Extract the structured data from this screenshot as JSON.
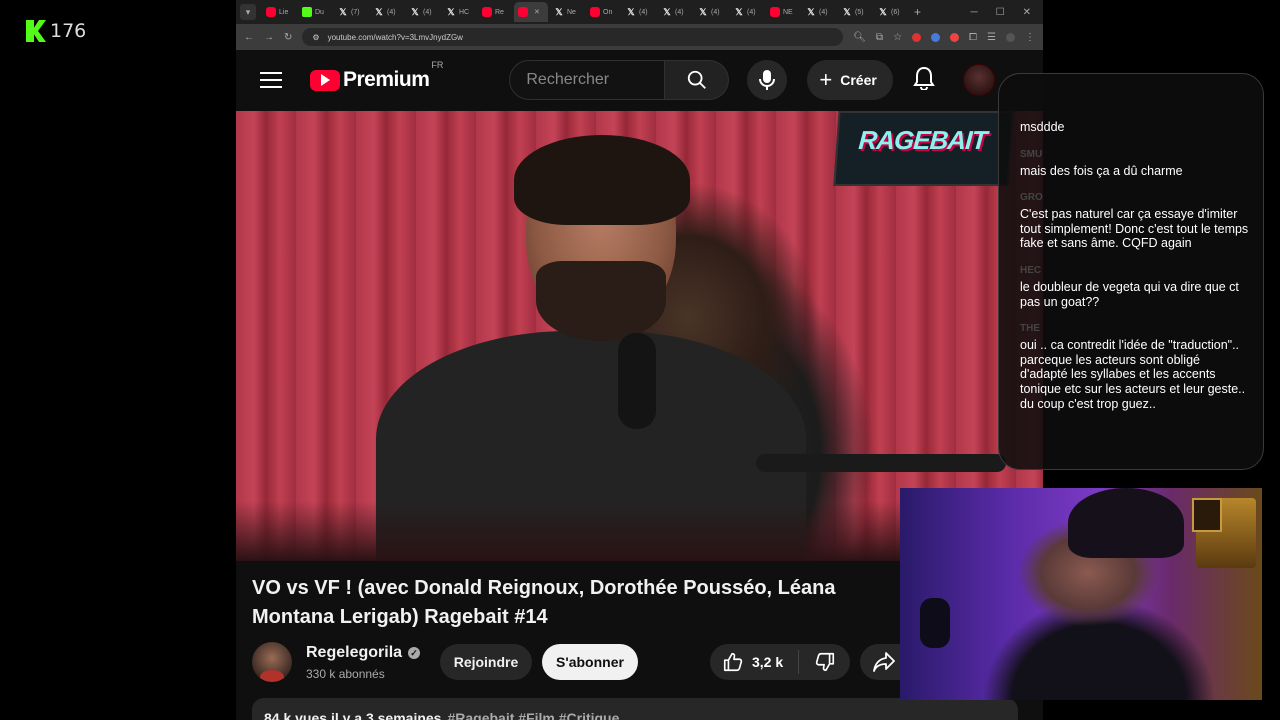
{
  "stream_badge": {
    "viewer_count": "176"
  },
  "browser": {
    "tabs": [
      {
        "icon": "yt",
        "label": "Lie"
      },
      {
        "icon": "k",
        "label": "Du"
      },
      {
        "icon": "x",
        "label": "(7)"
      },
      {
        "icon": "x",
        "label": "(4)"
      },
      {
        "icon": "x",
        "label": "(4)"
      },
      {
        "icon": "x",
        "label": "HC"
      },
      {
        "icon": "yt",
        "label": "Re"
      },
      {
        "icon": "yt",
        "label": "",
        "active": true
      },
      {
        "icon": "x",
        "label": "Ne"
      },
      {
        "icon": "yt",
        "label": "On"
      },
      {
        "icon": "x",
        "label": "(4)"
      },
      {
        "icon": "x",
        "label": "(4)"
      },
      {
        "icon": "x",
        "label": "(4)"
      },
      {
        "icon": "x",
        "label": "(4)"
      },
      {
        "icon": "yt",
        "label": "NE"
      },
      {
        "icon": "x",
        "label": "(4)"
      },
      {
        "icon": "x",
        "label": "(5)"
      },
      {
        "icon": "x",
        "label": "(6)"
      }
    ],
    "url": "youtube.com/watch?v=3LmvJnydZGw"
  },
  "youtube": {
    "brand": "Premium",
    "country": "FR",
    "search_placeholder": "Rechercher",
    "create_label": "Créer",
    "video_title": "VO vs VF ! (avec Donald Reignoux, Dorothée Pousséo, Léana Montana Lerigab) Ragebait #14",
    "channel_name": "Regelegorila",
    "subscribers": "330 k abonnés",
    "join_label": "Rejoindre",
    "subscribe_label": "S'abonner",
    "likes": "3,2 k",
    "description_meta": "84 k vues  il y a 3 semaines",
    "description_tags": "#Ragebait #Film #Critique",
    "thumbnail_sign_text": "RAGEBAIT"
  },
  "chat": {
    "messages": [
      {
        "user": "",
        "text": "msddde"
      },
      {
        "user": "SMU",
        "text": "mais des fois ça a dû charme"
      },
      {
        "user": "GRO",
        "text": "C'est pas naturel car ça essaye d'imiter tout simplement! Donc c'est tout le temps fake et sans âme. CQFD again"
      },
      {
        "user": "HEC",
        "text": "le doubleur de vegeta qui va dire que ct pas un goat??"
      },
      {
        "user": "THE",
        "text": "oui .. ca contredit l'idée de \"traduction\".. parceque les acteurs sont obligé d'adapté les syllabes et les accents tonique etc sur les acteurs et leur geste.. du coup c'est trop guez.."
      }
    ]
  }
}
